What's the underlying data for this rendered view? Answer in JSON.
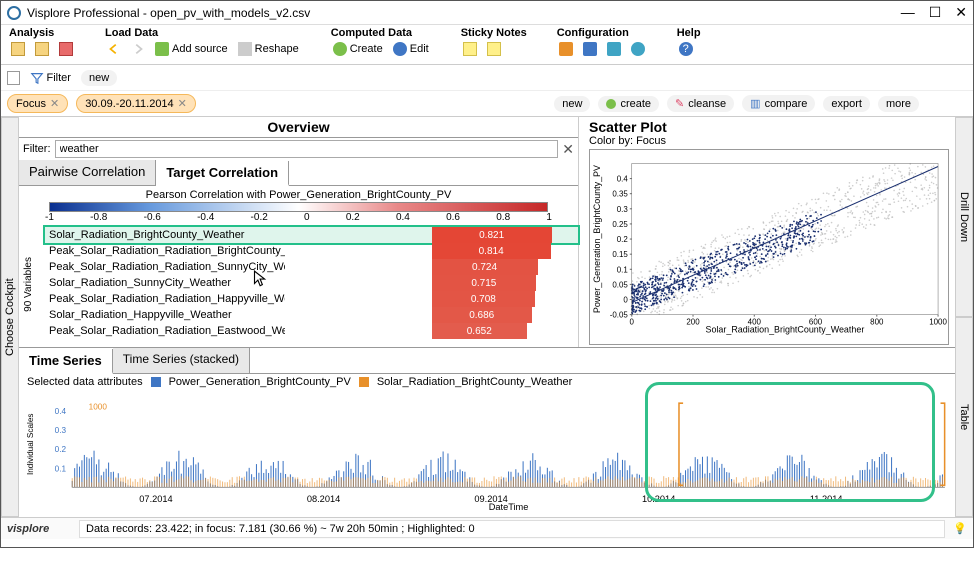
{
  "window": {
    "title": "Visplore Professional - open_pv_with_models_v2.csv"
  },
  "menus": {
    "analysis": {
      "title": "Analysis"
    },
    "loaddata": {
      "title": "Load Data",
      "addsource": "Add source",
      "reshape": "Reshape"
    },
    "computed": {
      "title": "Computed Data",
      "create": "Create",
      "edit": "Edit"
    },
    "sticky": {
      "title": "Sticky Notes"
    },
    "config": {
      "title": "Configuration"
    },
    "help": {
      "title": "Help"
    }
  },
  "filterbar": {
    "filter_label": "Filter",
    "new_label": "new",
    "focus": "Focus",
    "daterange": "30.09.-20.11.2014",
    "actions": {
      "new": "new",
      "create": "create",
      "cleanse": "cleanse",
      "compare": "compare",
      "export": "export",
      "more": "more"
    }
  },
  "sidetabs": {
    "left": "Choose Cockpit",
    "right_top": "Drill Down",
    "right_bottom": "Table"
  },
  "overview": {
    "title": "Overview",
    "filter_label": "Filter:",
    "filter_value": "weather",
    "tab1": "Pairwise Correlation",
    "tab2": "Target Correlation",
    "corr_header": "Pearson Correlation with Power_Generation_BrightCounty_PV",
    "ticks": [
      "-1",
      "-0.8",
      "-0.6",
      "-0.4",
      "-0.2",
      "0",
      "0.2",
      "0.4",
      "0.6",
      "0.8",
      "1"
    ],
    "vars_label": "90 Variables"
  },
  "scatter": {
    "title": "Scatter Plot",
    "colorby": "Color by: Focus",
    "xlabel": "Solar_Radiation_BrightCounty_Weather",
    "ylabel": "Power_Generation_BrightCounty_PV"
  },
  "timeseries": {
    "tab1": "Time Series",
    "tab2": "Time Series (stacked)",
    "legend_label": "Selected data attributes",
    "series1": "Power_Generation_BrightCounty_PV",
    "series2": "Solar_Radiation_BrightCounty_Weather",
    "xlabel": "DateTime",
    "yaxis_label": "Individual Scales"
  },
  "status": {
    "text": "Data records: 23.422; in focus: 7.181 (30.66 %) ~ 7w 20h 50min ; Highlighted: 0",
    "brand": "visplore"
  },
  "colors": {
    "series1": "#3F76C4",
    "series2": "#E8902A",
    "scatter_focus": "#1A2F6F",
    "scatter_other": "#B8B8B8",
    "highlight": "#32C08A"
  },
  "chart_data": [
    {
      "type": "bar",
      "title": "Pearson Correlation with Power_Generation_BrightCounty_PV",
      "xlim": [
        -1,
        1
      ],
      "rows": [
        {
          "label": "Solar_Radiation_BrightCounty_Weather",
          "value": 0.821,
          "selected": true
        },
        {
          "label": "Peak_Solar_Radiation_Radiation_BrightCounty_Weather",
          "value": 0.814
        },
        {
          "label": "Peak_Solar_Radiation_Radiation_SunnyCity_Weather",
          "value": 0.724
        },
        {
          "label": "Solar_Radiation_SunnyCity_Weather",
          "value": 0.715
        },
        {
          "label": "Peak_Solar_Radiation_Radiation_Happyville_Weather",
          "value": 0.708
        },
        {
          "label": "Solar_Radiation_Happyville_Weather",
          "value": 0.686
        },
        {
          "label": "Peak_Solar_Radiation_Radiation_Eastwood_Weather",
          "value": 0.652
        }
      ]
    },
    {
      "type": "scatter",
      "title": "Scatter Plot",
      "xlabel": "Solar_Radiation_BrightCounty_Weather",
      "ylabel": "Power_Generation_BrightCounty_PV",
      "xlim": [
        0,
        1000
      ],
      "ylim": [
        -0.05,
        0.45
      ],
      "xticks": [
        0,
        200,
        400,
        600,
        800,
        1000
      ],
      "yticks": [
        -0.05,
        0,
        0.05,
        0.1,
        0.15,
        0.2,
        0.25,
        0.3,
        0.35,
        0.4
      ],
      "note": "Dense cloud; positive trend; focus subset clustered lower-left along regression line",
      "regression": {
        "x0": 0,
        "y0": -0.01,
        "x1": 1000,
        "y1": 0.44
      }
    },
    {
      "type": "line",
      "title": "Time Series",
      "xlabel": "DateTime",
      "xticks": [
        "07.2014",
        "08.2014",
        "09.2014",
        "10.2014",
        "11.2014"
      ],
      "series": [
        {
          "name": "Power_Generation_BrightCounty_PV",
          "ylim": [
            0,
            0.45
          ],
          "yticks": [
            0.1,
            0.2,
            0.3,
            0.4
          ],
          "note": "dense daily spikes"
        },
        {
          "name": "Solar_Radiation_BrightCounty_Weather",
          "ylim": [
            0,
            1000
          ],
          "yticks": [
            1000
          ],
          "note": "dense daily spikes"
        }
      ],
      "focus_window": [
        "30.09.2014",
        "20.11.2014"
      ]
    }
  ]
}
